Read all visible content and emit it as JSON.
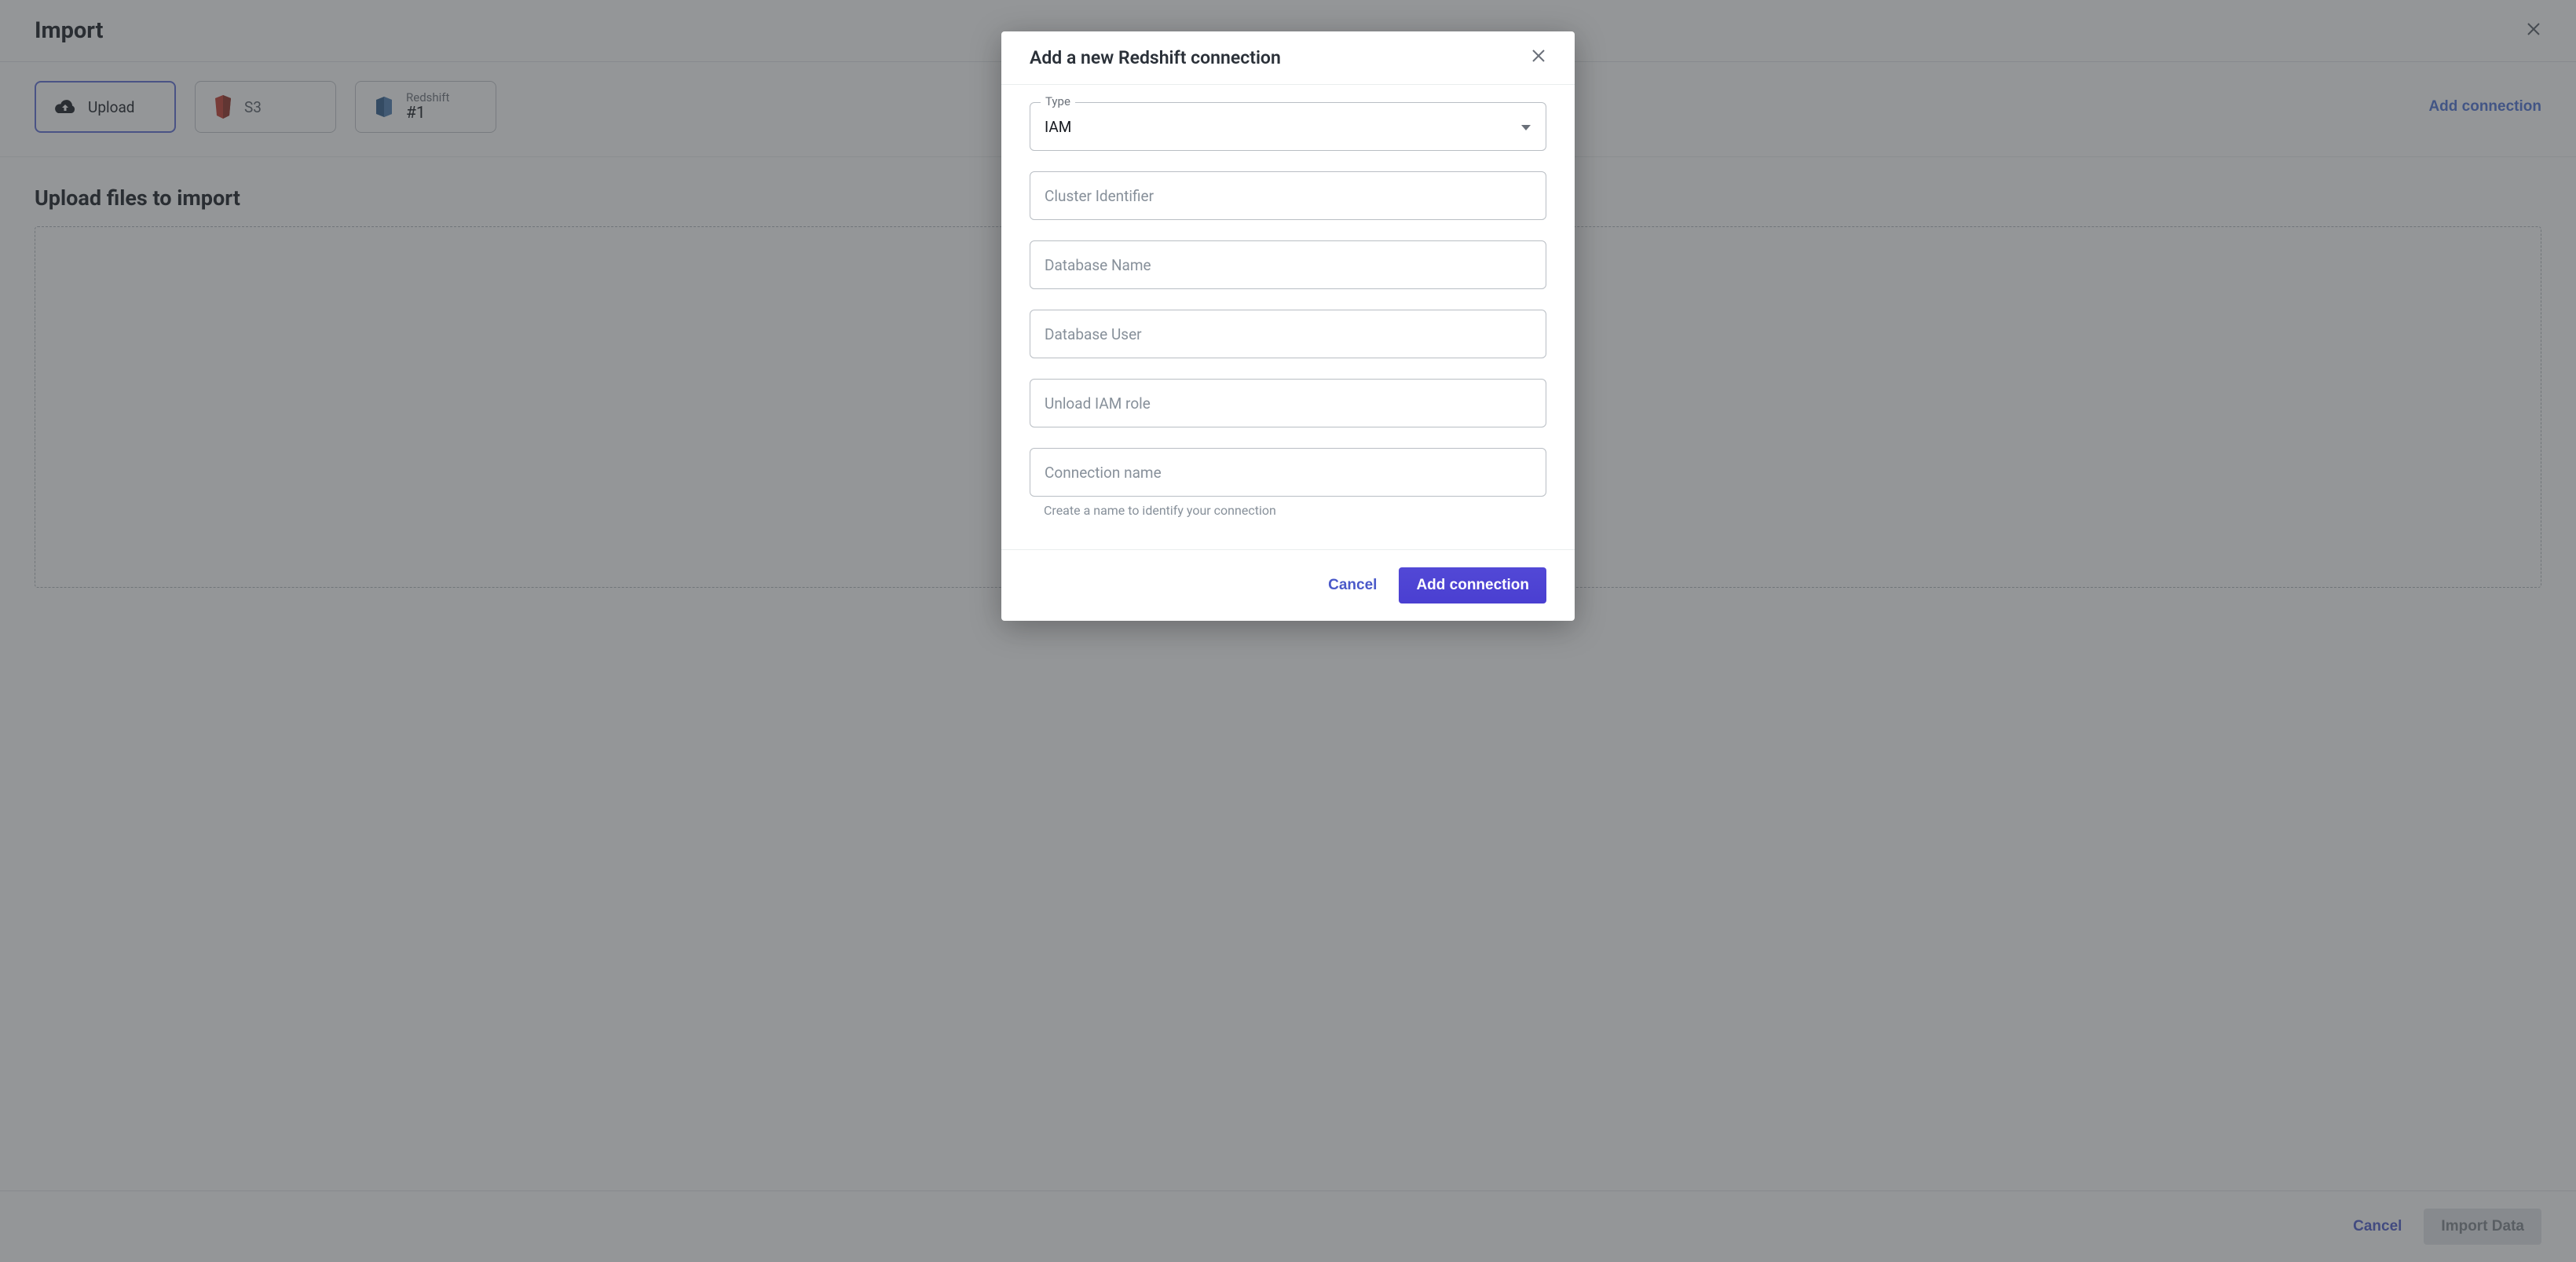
{
  "page": {
    "title": "Import",
    "section_title": "Upload files to import",
    "add_connection_link": "Add connection"
  },
  "sources": {
    "upload": {
      "label": "Upload"
    },
    "s3": {
      "label": "S3"
    },
    "redshift": {
      "top": "Redshift",
      "bottom": "#1"
    }
  },
  "footer": {
    "cancel": "Cancel",
    "import": "Import Data"
  },
  "modal": {
    "title": "Add a new Redshift connection",
    "type_label": "Type",
    "type_value": "IAM",
    "fields": {
      "cluster_identifier": "Cluster Identifier",
      "database_name": "Database Name",
      "database_user": "Database User",
      "unload_iam_role": "Unload IAM role",
      "connection_name": "Connection name"
    },
    "connection_name_helper": "Create a name to identify your connection",
    "cancel": "Cancel",
    "submit": "Add connection"
  }
}
